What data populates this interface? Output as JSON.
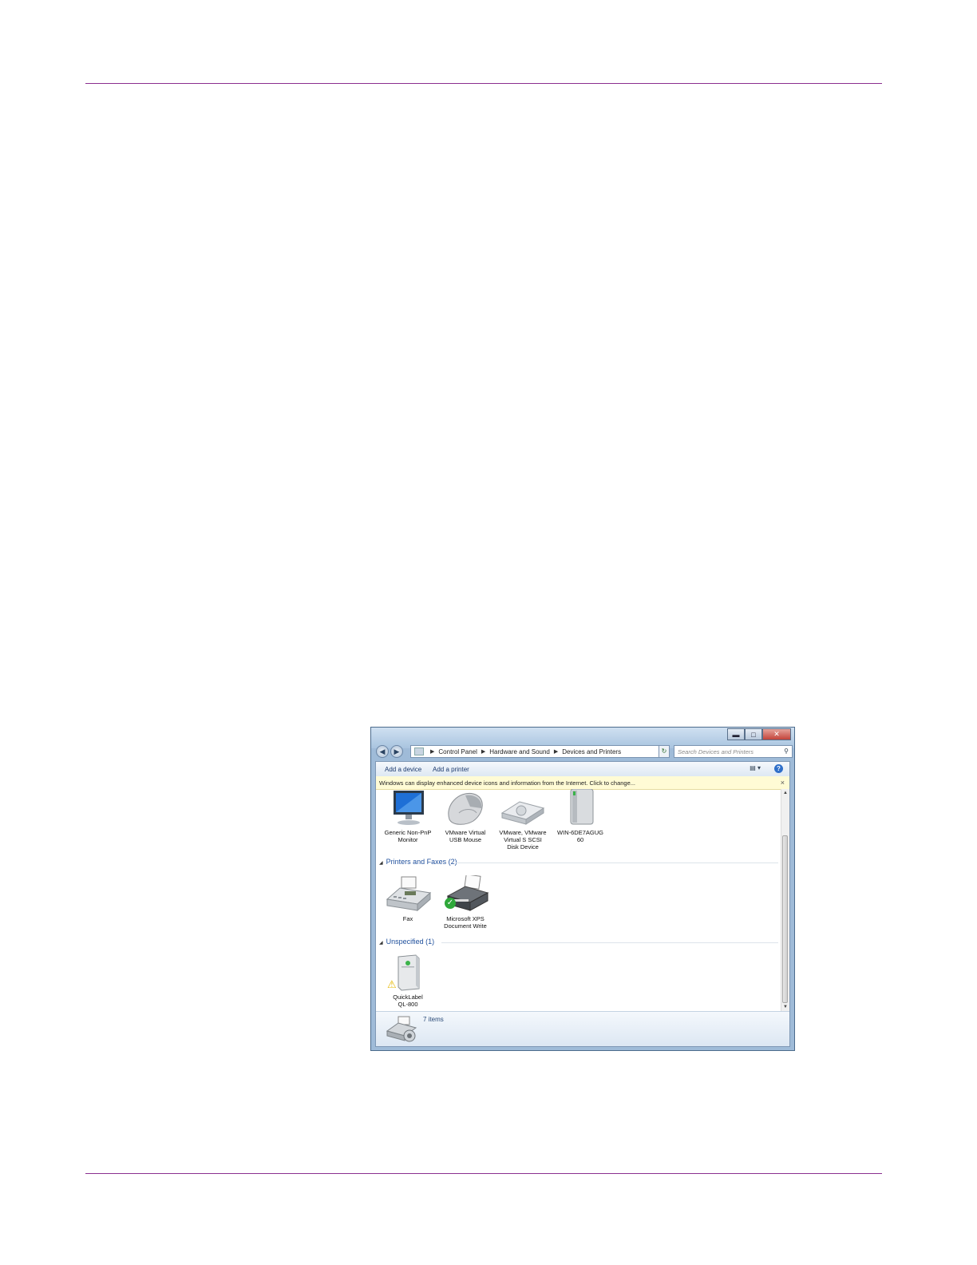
{
  "window": {
    "address": {
      "crumbs": [
        "Control Panel",
        "Hardware and Sound",
        "Devices and Printers"
      ]
    },
    "search_placeholder": "Search Devices and Printers",
    "toolbar": {
      "add_device": "Add a device",
      "add_printer": "Add a printer"
    },
    "infobar": "Windows can display enhanced device icons and information from the Internet. Click to change...",
    "devices": [
      {
        "line1": "Generic Non-PnP",
        "line2": "Monitor",
        "line3": "",
        "icon": "monitor-icon"
      },
      {
        "line1": "VMware Virtual",
        "line2": "USB Mouse",
        "line3": "",
        "icon": "mouse-icon"
      },
      {
        "line1": "VMware, VMware",
        "line2": "Virtual S SCSI",
        "line3": "Disk Device",
        "icon": "disk-drive-icon"
      },
      {
        "line1": "WIN-6DE7AGUG",
        "line2": "60",
        "line3": "",
        "icon": "computer-tower-icon"
      }
    ],
    "groups": {
      "printers": "Printers and Faxes (2)",
      "unspecified": "Unspecified (1)"
    },
    "printers": [
      {
        "line1": "Fax",
        "line2": "",
        "icon": "fax-icon"
      },
      {
        "line1": "Microsoft XPS",
        "line2": "Document Write",
        "icon": "printer-icon"
      }
    ],
    "unspecified": [
      {
        "line1": "QuickLabel",
        "line2": "QL-800",
        "icon": "label-printer-icon"
      }
    ],
    "status": "7 items"
  }
}
